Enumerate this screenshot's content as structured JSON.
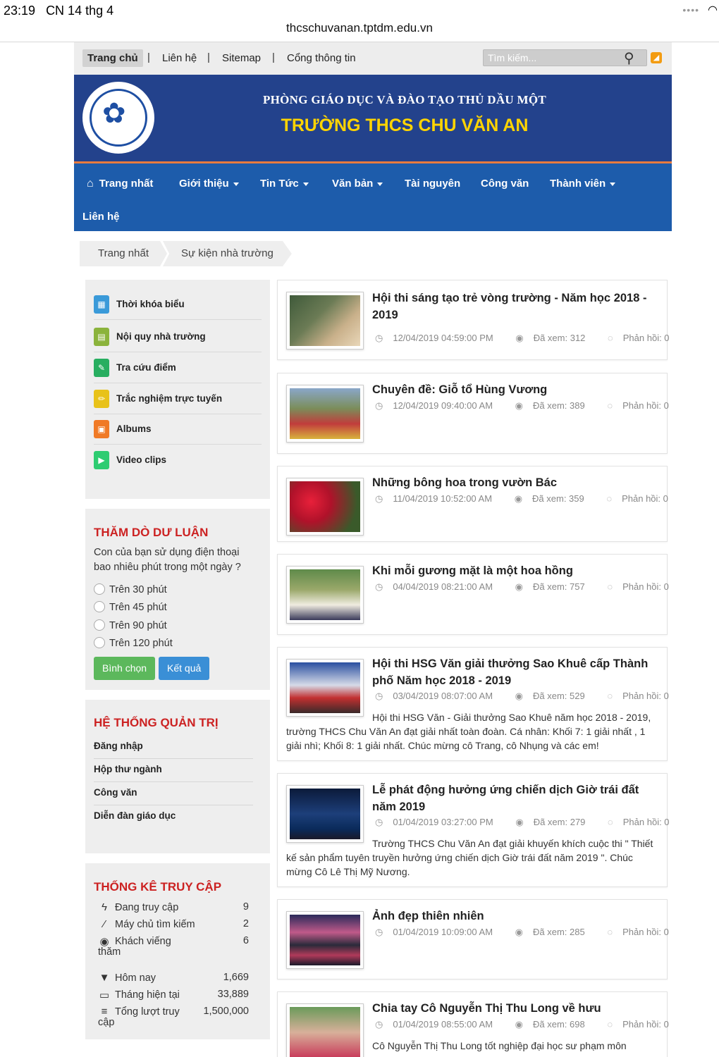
{
  "status_bar": {
    "time": "23:19",
    "date": "CN 14 thg 4"
  },
  "url": "thcschuvanan.tptdm.edu.vn",
  "top_links": {
    "home": "Trang chủ",
    "contact": "Liên hệ",
    "sitemap": "Sitemap",
    "portal": "Cổng thông tin",
    "search_placeholder": "Tìm kiếm..."
  },
  "banner": {
    "department": "PHÒNG GIÁO DỤC VÀ ĐÀO TẠO THỦ DẦU MỘT",
    "school": "TRƯỜNG THCS CHU VĂN AN"
  },
  "nav": [
    "Trang nhất",
    "Giới thiệu",
    "Tin Tức",
    "Văn bản",
    "Tài nguyên",
    "Công văn",
    "Thành viên",
    "Liên hệ"
  ],
  "breadcrumb": [
    "Trang nhất",
    "Sự kiện nhà trường"
  ],
  "quick_links": [
    {
      "label": "Thời khóa biểu",
      "icon": "calendar-icon",
      "color": "#3a9ad9"
    },
    {
      "label": "Nội quy nhà trường",
      "icon": "book-icon",
      "color": "#8bb33c"
    },
    {
      "label": "Tra cứu điểm",
      "icon": "edit-icon",
      "color": "#27ae60"
    },
    {
      "label": "Trắc nghiệm trực tuyến",
      "icon": "pencil-icon",
      "color": "#e8c21a"
    },
    {
      "label": "Albums",
      "icon": "image-icon",
      "color": "#f07a26"
    },
    {
      "label": "Video clips",
      "icon": "video-icon",
      "color": "#2ecc71"
    }
  ],
  "poll": {
    "title": "THĂM DÒ DƯ LUẬN",
    "question": "Con của bạn sử dụng điện thoại bao nhiêu phút trong một ngày ?",
    "options": [
      "Trên 30 phút",
      "Trên 45 phút",
      "Trên 90 phút",
      "Trên 120 phút"
    ],
    "vote_label": "Bình chọn",
    "result_label": "Kết quả"
  },
  "admin": {
    "title": "HỆ THỐNG QUẢN TRỊ",
    "links": [
      "Đăng nhập",
      "Hộp thư ngành",
      "Công văn",
      "Diễn đàn giáo dục"
    ]
  },
  "stats": {
    "title": "THỐNG KÊ TRUY CẬP",
    "rows": [
      {
        "label": "Đang truy cập",
        "value": "9",
        "icon": "bolt-icon"
      },
      {
        "label": "Máy chủ tìm kiếm",
        "value": "2",
        "icon": "wand-icon"
      },
      {
        "label": "Khách viếng",
        "label2": "thăm",
        "value": "6",
        "icon": "target-icon"
      },
      {
        "label": "Hôm nay",
        "value": "1,669",
        "icon": "filter-icon"
      },
      {
        "label": "Tháng hiện tại",
        "value": "33,889",
        "icon": "calendar-icon"
      },
      {
        "label": "Tổng lượt truy",
        "label2": "cập",
        "value": "1,500,000",
        "icon": "list-icon"
      }
    ]
  },
  "articles": [
    {
      "title": "Hội thi sáng tạo trẻ vòng trường - Năm học 2018 - 2019",
      "date": "12/04/2019 04:59:00 PM",
      "views": "Đã xem: 312",
      "replies": "Phản hồi: 0",
      "excerpt": ""
    },
    {
      "title": "Chuyên đề: Giỗ tổ Hùng Vương",
      "date": "12/04/2019 09:40:00 AM",
      "views": "Đã xem: 389",
      "replies": "Phản hồi: 0",
      "excerpt": ""
    },
    {
      "title": "Những bông hoa trong vườn Bác",
      "date": "11/04/2019 10:52:00 AM",
      "views": "Đã xem: 359",
      "replies": "Phản hồi: 0",
      "excerpt": ""
    },
    {
      "title": "Khi mỗi gương mặt là một hoa hồng",
      "date": "04/04/2019 08:21:00 AM",
      "views": "Đã xem: 757",
      "replies": "Phản hồi: 0",
      "excerpt": ""
    },
    {
      "title": "Hội thi HSG Văn giải thưởng Sao Khuê cấp Thành phố Năm học 2018 - 2019",
      "date": "03/04/2019 08:07:00 AM",
      "views": "Đã xem: 529",
      "replies": "Phản hồi: 0",
      "excerpt": "Hội thi HSG Văn - Giải thưởng Sao Khuê năm học 2018 - 2019, trường THCS Chu Văn An đạt giải nhất toàn đoàn. Cá nhân: Khối 7: 1 giải nhất , 1 giải nhì; Khối 8: 1 giải nhất. Chúc mừng cô Trang, cô Nhụng và các em!"
    },
    {
      "title": "Lễ phát động hưởng ứng chiến dịch Giờ trái đất năm 2019",
      "date": "01/04/2019 03:27:00 PM",
      "views": "Đã xem: 279",
      "replies": "Phản hồi: 0",
      "excerpt": "Trường THCS Chu Văn An đạt giải khuyến khích cuộc thi \" Thiết kế sản phẩm tuyên truyền hưởng ứng chiến dịch Giờ trái đất năm 2019 \". Chúc mừng Cô Lê Thị Mỹ Nương."
    },
    {
      "title": "Ảnh đẹp thiên nhiên",
      "date": "01/04/2019 10:09:00 AM",
      "views": "Đã xem: 285",
      "replies": "Phản hồi: 0",
      "excerpt": ""
    },
    {
      "title": "Chia tay Cô Nguyễn Thị Thu Long về hưu",
      "date": "01/04/2019 08:55:00 AM",
      "views": "Đã xem: 698",
      "replies": "Phản hồi: 0",
      "excerpt": "Cô Nguyễn Thị Thu Long tốt nghiệp đại học sư phạm môn"
    }
  ]
}
